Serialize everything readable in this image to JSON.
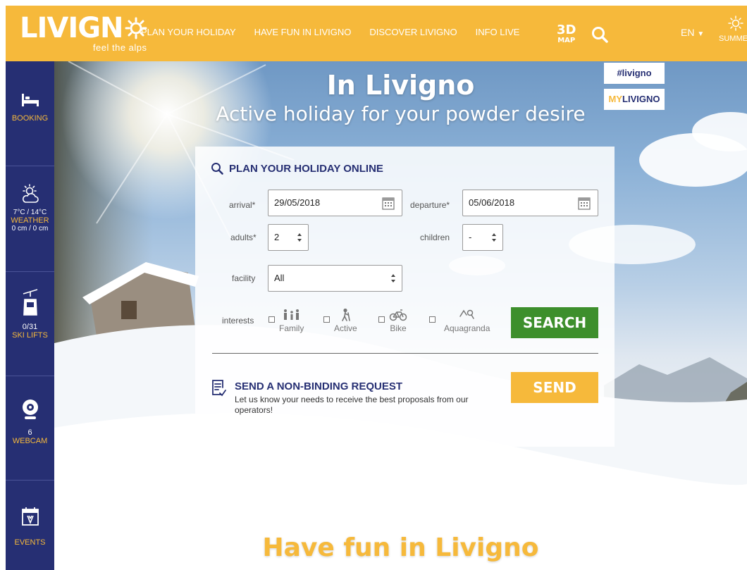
{
  "header": {
    "logo": {
      "name": "LIVIGN",
      "tagline": "feel the alps"
    },
    "nav": [
      {
        "label": "PLAN YOUR HOLIDAY"
      },
      {
        "label": "HAVE FUN IN LIVIGNO"
      },
      {
        "label": "DISCOVER LIVIGNO"
      },
      {
        "label": "INFO LIVE"
      }
    ],
    "map3d": {
      "top": "3D",
      "bottom": "MAP"
    },
    "language": "EN",
    "season": "SUMMER"
  },
  "sidebar": {
    "booking": {
      "label": "BOOKING"
    },
    "weather": {
      "temp": "7°C / 14°C",
      "label": "WEATHER",
      "snow": "0 cm / 0 cm"
    },
    "ski_lifts": {
      "count": "0/31",
      "label": "SKI LIFTS"
    },
    "webcam": {
      "count": "6",
      "label": "WEBCAM"
    },
    "events": {
      "label": "EVENTS"
    }
  },
  "hero": {
    "title": "In Livigno",
    "subtitle": "Active holiday for your powder desire",
    "hashtag": "#livigno",
    "mylivigno": {
      "prefix": "MY",
      "suffix": "LIVIGNO"
    },
    "bottom_title": "Have fun in Livigno"
  },
  "form": {
    "title": "PLAN YOUR HOLIDAY ONLINE",
    "arrival": {
      "label": "arrival*",
      "value": "29/05/2018"
    },
    "departure": {
      "label": "departure*",
      "value": "05/06/2018"
    },
    "adults": {
      "label": "adults*",
      "value": "2"
    },
    "children": {
      "label": "children",
      "value": "-"
    },
    "facility": {
      "label": "facility",
      "value": "All"
    },
    "interests": {
      "label": "interests",
      "options": [
        {
          "label": "Family"
        },
        {
          "label": "Active"
        },
        {
          "label": "Bike"
        },
        {
          "label": "Aquagranda"
        }
      ]
    },
    "search_button": "SEARCH",
    "request": {
      "title": "SEND A NON-BINDING REQUEST",
      "description": "Let us know your needs to receive the best proposals from our operators!",
      "send_button": "SEND"
    }
  },
  "colors": {
    "accent": "#f6b93b",
    "navy": "#262f73",
    "green": "#3d8f2c"
  }
}
